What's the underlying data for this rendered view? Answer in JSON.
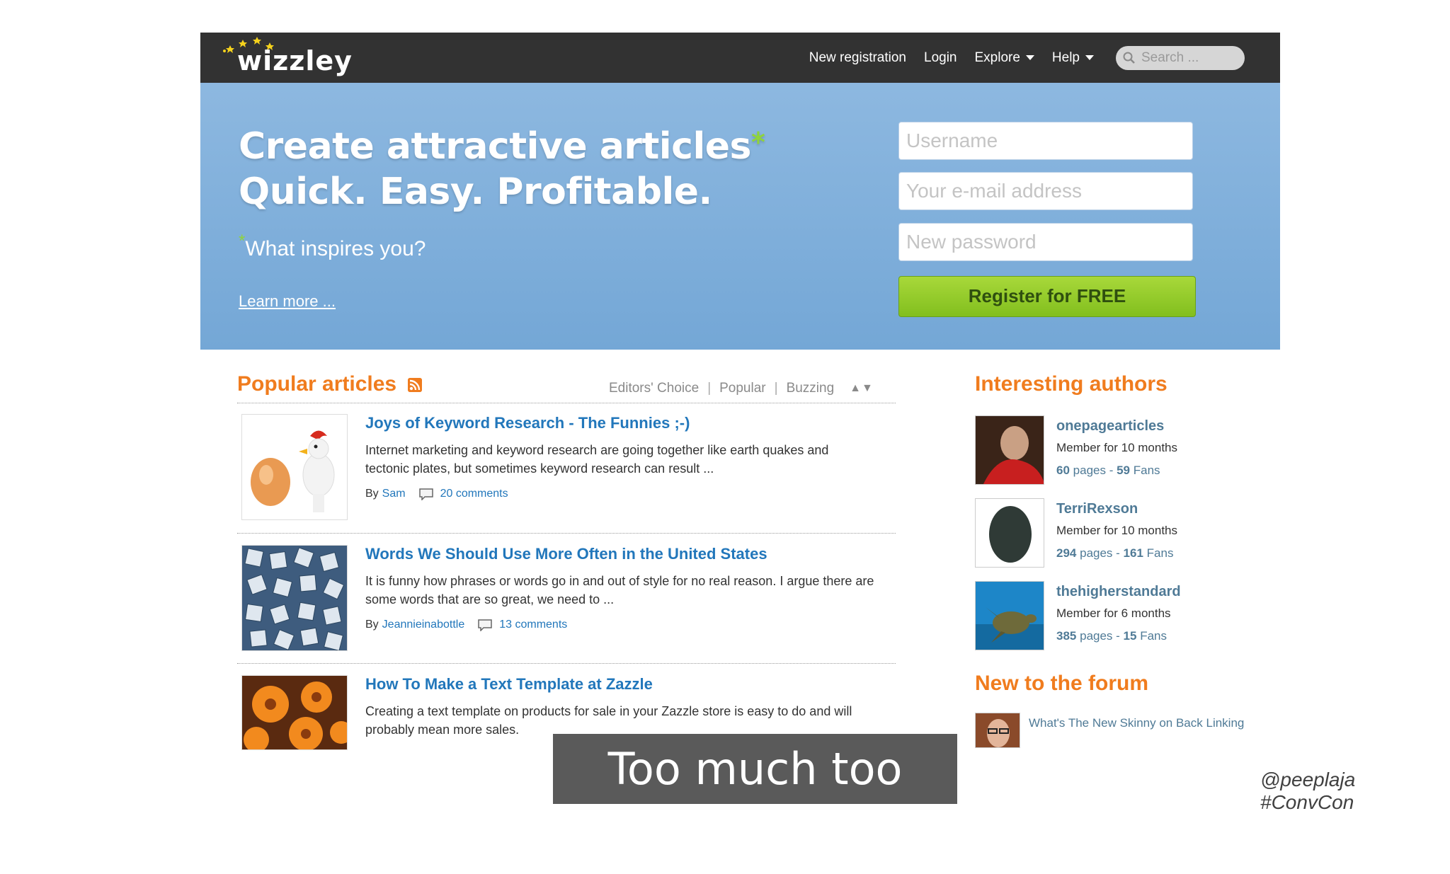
{
  "site": {
    "logo_text": "wizzley",
    "nav": {
      "new_registration": "New registration",
      "login": "Login",
      "explore": "Explore",
      "help": "Help",
      "search_placeholder": "Search ..."
    }
  },
  "hero": {
    "headline_line1": "Create attractive articles",
    "headline_line2": "Quick. Easy. Profitable.",
    "asterisk": "*",
    "tagline": "What inspires you?",
    "learn_more": "Learn more ...",
    "username_placeholder": "Username",
    "email_placeholder": "Your e-mail address",
    "password_placeholder": "New password",
    "register_label": "Register for FREE"
  },
  "popular": {
    "title": "Popular articles",
    "tabs": [
      "Editors' Choice",
      "Popular",
      "Buzzing"
    ],
    "sort_arrows": "▲▼",
    "articles": [
      {
        "title": "Joys of Keyword Research - The Funnies ;-)",
        "description": "Internet marketing and keyword research are going together like earth quakes and tectonic plates, but sometimes keyword research can result ...",
        "by_label": "By",
        "author": "Sam",
        "comments": "20 comments"
      },
      {
        "title": "Words We Should Use More Often in the United States",
        "description": "It is funny how phrases or words go in and out of style for no real reason. I argue there are some words that are so great, we need to ...",
        "by_label": "By",
        "author": "Jeannieinabottle",
        "comments": "13 comments"
      },
      {
        "title": "How To Make a Text Template at Zazzle",
        "description": "Creating a text template on products for sale in your Zazzle store is easy to do and will probably mean more sales."
      }
    ]
  },
  "authors": {
    "title": "Interesting authors",
    "items": [
      {
        "name": "onepagearticles",
        "member": "Member for 10 months",
        "pages": "60",
        "pages_label": "pages -",
        "fans": "59",
        "fans_label": "Fans"
      },
      {
        "name": "TerriRexson",
        "member": "Member for 10 months",
        "pages": "294",
        "pages_label": "pages -",
        "fans": "161",
        "fans_label": "Fans"
      },
      {
        "name": "thehigherstandard",
        "member": "Member for 6 months",
        "pages": "385",
        "pages_label": "pages -",
        "fans": "15",
        "fans_label": "Fans"
      }
    ]
  },
  "forum": {
    "title": "New to the forum",
    "item": "What's The New Skinny on Back Linking"
  },
  "overlay": {
    "caption": "Too much too soon",
    "handle": "@peeplaja #ConvCon"
  },
  "colors": {
    "topbar": "#323232",
    "hero": "#7eafdb",
    "accent_orange": "#f07c1e",
    "link_blue": "#2277bb",
    "register_green": "#94cb2c"
  }
}
